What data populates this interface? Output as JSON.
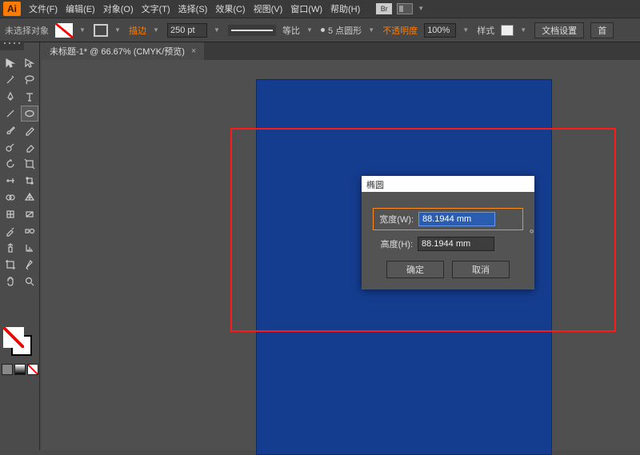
{
  "menubar": {
    "logo": "Ai",
    "items": [
      "文件(F)",
      "编辑(E)",
      "对象(O)",
      "文字(T)",
      "选择(S)",
      "效果(C)",
      "视图(V)",
      "窗口(W)",
      "帮助(H)"
    ],
    "bridge": "Br"
  },
  "optbar": {
    "status": "未选择对象",
    "stroke_label": "描边",
    "stroke_width": "250 pt",
    "brush_label": "等比",
    "profile": "5 点圆形",
    "opacity_label": "不透明度",
    "opacity_value": "100%",
    "style_label": "样式",
    "docsetup": "文档设置",
    "prefs": "首"
  },
  "tab": {
    "label": "未标题-1* @ 66.67% (CMYK/预览)",
    "close": "×"
  },
  "dialog": {
    "title": "椭圆",
    "width_label": "宽度(W)",
    "height_label": "高度(H)",
    "width_value": "88.1944 mm",
    "height_value": "88.1944 mm",
    "ok": "确定",
    "cancel": "取消"
  },
  "tools_left": [
    "selection",
    "lasso",
    "pen",
    "line",
    "brush",
    "pencil",
    "rotate",
    "width",
    "shaper",
    "grad",
    "eyedrop",
    "artboard",
    "hand"
  ],
  "tools_right": [
    "direct",
    "wand",
    "type",
    "ellipse",
    "blob",
    "eraser",
    "scale",
    "free",
    "mesh",
    "blend",
    "slice",
    "zoom",
    "graph"
  ]
}
